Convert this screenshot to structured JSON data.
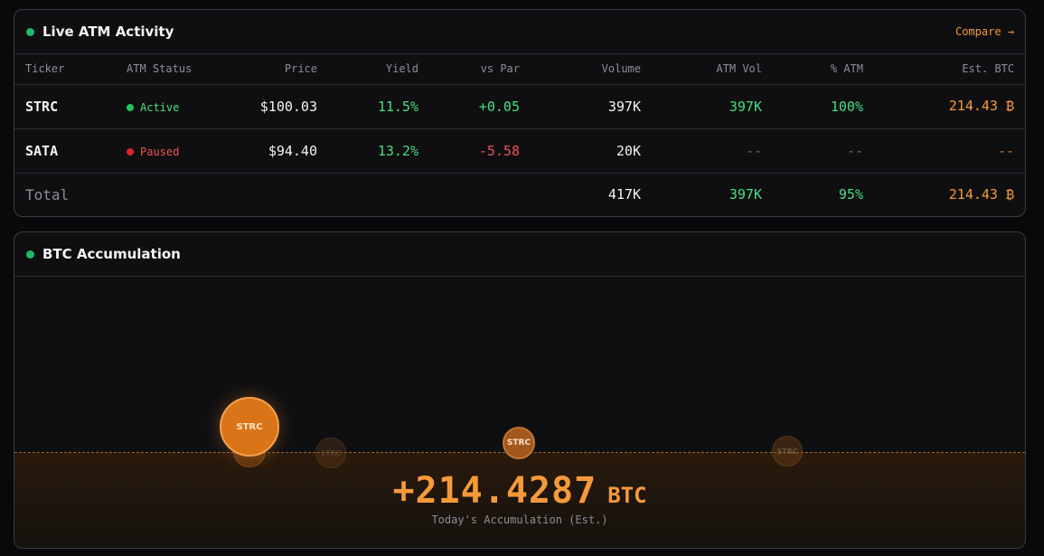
{
  "atm_panel": {
    "title": "Live ATM Activity",
    "compare_label": "Compare →",
    "columns": [
      "Ticker",
      "ATM Status",
      "Price",
      "Yield",
      "vs Par",
      "Volume",
      "ATM Vol",
      "% ATM",
      "Est. BTC"
    ],
    "rows": [
      {
        "ticker": "STRC",
        "status": "Active",
        "price": "$100.03",
        "yield": "11.5%",
        "vs_par": "+0.05",
        "volume": "397K",
        "atm_vol": "397K",
        "pct_atm": "100%",
        "est_btc": "214.43 ₿"
      },
      {
        "ticker": "SATA",
        "status": "Paused",
        "price": "$94.40",
        "yield": "13.2%",
        "vs_par": "-5.58",
        "volume": "20K",
        "atm_vol": "--",
        "pct_atm": "--",
        "est_btc": "--"
      }
    ],
    "total": {
      "label": "Total",
      "volume": "417K",
      "atm_vol": "397K",
      "pct_atm": "95%",
      "est_btc": "214.43 ₿"
    }
  },
  "accumulation_panel": {
    "title": "BTC Accumulation",
    "bubbles": [
      "STRC",
      "STRC",
      "STRC",
      "STRC",
      "STRC"
    ],
    "value": "+214.4287",
    "unit": "BTC",
    "caption": "Today's Accumulation (Est.)"
  },
  "colors": {
    "accent_orange": "#f59a3a",
    "positive_green": "#4ade80",
    "negative_red": "#f05252",
    "live_dot": "#22b866"
  }
}
